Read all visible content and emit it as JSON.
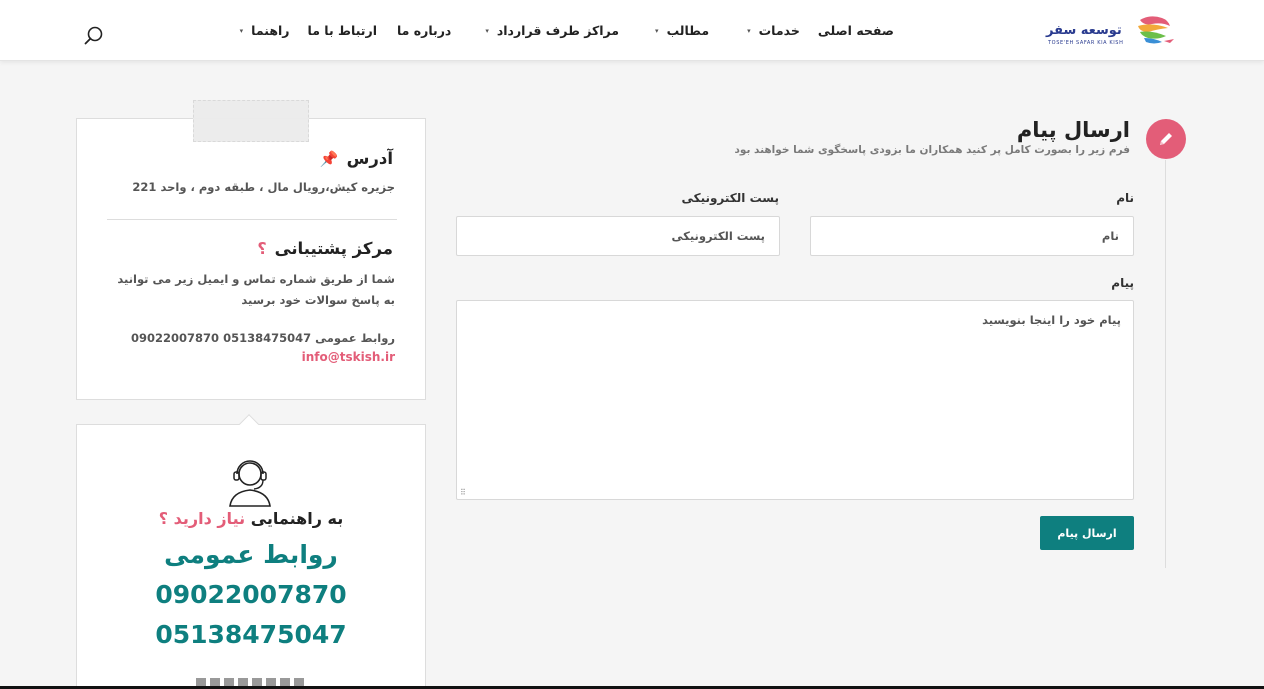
{
  "header": {
    "logo_text": "TOSE'EH SAFAR KIA KISH",
    "nav": [
      {
        "label": "صفحه اصلی",
        "dropdown": false
      },
      {
        "label": "خدمات",
        "dropdown": true
      },
      {
        "label": "مطالب",
        "dropdown": true
      },
      {
        "label": "مراکز طرف قرارداد",
        "dropdown": true
      },
      {
        "label": "درباره ما",
        "dropdown": false
      },
      {
        "label": "ارتباط با ما",
        "dropdown": false
      },
      {
        "label": "راهنما",
        "dropdown": true
      }
    ],
    "search_icon": "search-icon"
  },
  "form": {
    "title": "ارسال پیام",
    "subtitle": "فرم زیر را بصورت کامل پر کنید همکاران ما بزودی پاسخگوی شما خواهند بود",
    "name_label": "نام",
    "name_placeholder": "نام",
    "email_label": "پست الکترونیکی",
    "email_placeholder": "پست الکترونیکی",
    "message_label": "پیام",
    "message_placeholder": "پیام خود را اینجا بنویسید",
    "submit_label": "ارسال پیام"
  },
  "info_card": {
    "address_title": "آدرس",
    "address_text": "جزیره کیش،رویال مال ، طبقه دوم ، واحد 221",
    "support_title": "مرکز پشتیبانی",
    "support_mark": "؟",
    "support_text": "شما از طریق شماره تماس و ایمیل زیر می توانید به پاسخ سوالات خود برسید",
    "contact_line": "روابط عمومی 05138475047 09022007870",
    "email": "info@tskish.ir"
  },
  "help_card": {
    "question_prefix": "به راهنمایی",
    "question_highlight": "نیاز دارید ؟",
    "heading": "روابط عمومی",
    "phone1": "09022007870",
    "phone2": "05138475047"
  },
  "colors": {
    "accent_pink": "#e35d78",
    "accent_teal": "#0e7f7f"
  }
}
